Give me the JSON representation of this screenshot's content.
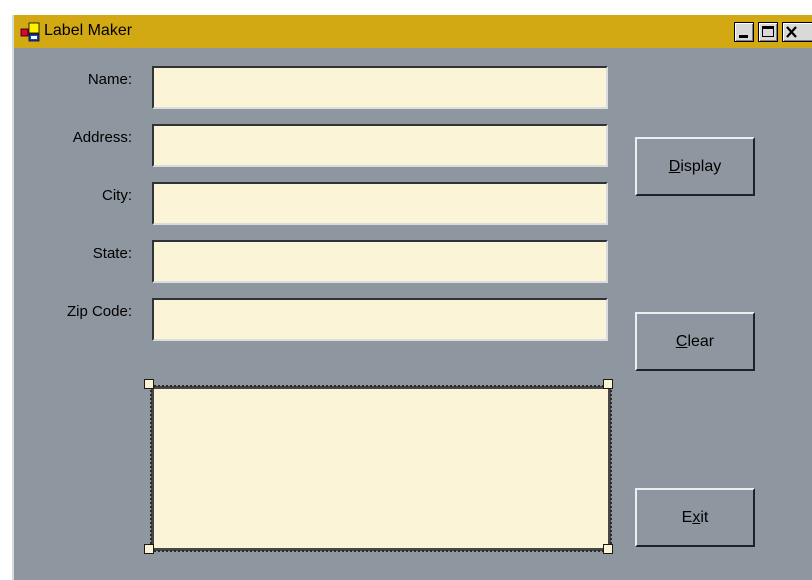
{
  "window": {
    "title": "Label Maker",
    "icons": [
      "app-icon"
    ],
    "caption_buttons": [
      "minimize-icon",
      "maximize-icon",
      "close-icon"
    ]
  },
  "form": {
    "fields": [
      {
        "label": "Name:",
        "value": ""
      },
      {
        "label": "Address:",
        "value": ""
      },
      {
        "label": "City:",
        "value": ""
      },
      {
        "label": "State:",
        "value": ""
      },
      {
        "label": "Zip Code:",
        "value": ""
      }
    ],
    "output_text": ""
  },
  "buttons": {
    "display": {
      "pre": "",
      "key": "D",
      "post": "isplay"
    },
    "clear": {
      "pre": "",
      "key": "C",
      "post": "lear"
    },
    "exit": {
      "pre": "E",
      "key": "x",
      "post": "it"
    }
  },
  "colors": {
    "titlebar": "#d2a912",
    "form_bg": "#8e979f",
    "input_bg": "#fcf4d6"
  }
}
